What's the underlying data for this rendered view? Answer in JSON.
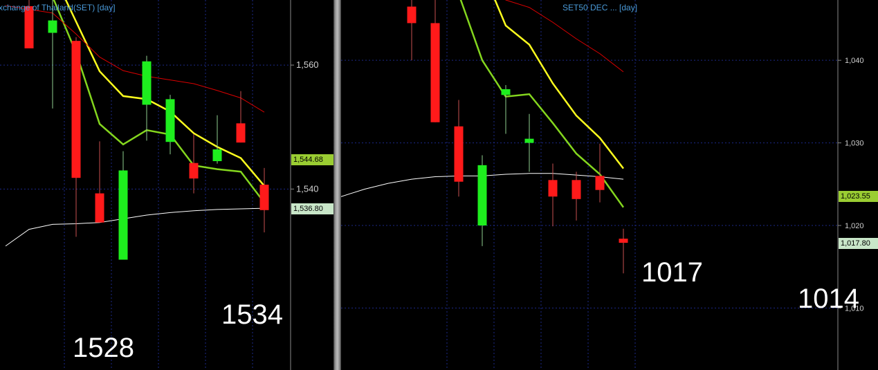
{
  "colors": {
    "background": "#000000",
    "grid": "#1c2a8a",
    "up_candle": "#1eee1e",
    "down_candle": "#ff1a1a",
    "wick": "#cfcfcf",
    "ma_fast": "#ffff1e",
    "ma_mid": "#84d61e",
    "ma_slow": "#dc0000",
    "ma_long": "#ffffff",
    "axis_text": "#d0d0d0",
    "title_text": "#4a9ad8",
    "tag_green": "#9acd32",
    "tag_light": "#c8e6c8"
  },
  "chart_data": [
    {
      "type": "candlestick",
      "title": "xchange of Thailand(SET) [day]",
      "ylim": [
        1510.8,
        1570.5
      ],
      "y_ticks": [
        1540,
        1560
      ],
      "y_tick_labels": [
        "1,540",
        "1,560"
      ],
      "gridlines": true,
      "last_price_tags": [
        {
          "label": "1,544.68",
          "value": 1544.68,
          "style": "green"
        },
        {
          "label": "1,536.80",
          "value": 1536.8,
          "style": "light"
        }
      ],
      "annotations": [
        {
          "text": "1528",
          "x": 5
        },
        {
          "text": "1534",
          "x": 11
        }
      ],
      "x": [
        1,
        2,
        3,
        4,
        5,
        6,
        7,
        8,
        9,
        10,
        11
      ],
      "candles": [
        {
          "open": 1569.5,
          "high": 1575,
          "low": 1565.8,
          "close": 1562.7
        },
        {
          "open": 1565.2,
          "high": 1573.2,
          "low": 1553.0,
          "close": 1567.2
        },
        {
          "open": 1563.9,
          "high": 1564.5,
          "low": 1532.3,
          "close": 1541.8
        },
        {
          "open": 1539.3,
          "high": 1547.7,
          "low": 1535.2,
          "close": 1534.6
        },
        {
          "open": 1528.6,
          "high": 1546.1,
          "low": 1529.1,
          "close": 1543.0
        },
        {
          "open": 1553.6,
          "high": 1561.5,
          "low": 1547.8,
          "close": 1560.6
        },
        {
          "open": 1547.6,
          "high": 1555.2,
          "low": 1545.6,
          "close": 1554.5
        },
        {
          "open": 1544.2,
          "high": 1548.9,
          "low": 1539.3,
          "close": 1541.7
        },
        {
          "open": 1544.5,
          "high": 1551.9,
          "low": 1544.1,
          "close": 1546.4
        },
        {
          "open": 1550.6,
          "high": 1555.8,
          "low": 1547.5,
          "close": 1547.5
        },
        {
          "open": 1540.7,
          "high": 1543.4,
          "low": 1533.0,
          "close": 1536.6
        }
      ],
      "series": [
        {
          "color": "#ffff1e",
          "x": [
            2,
            3,
            4,
            5,
            6,
            7,
            8,
            9,
            10,
            11
          ],
          "values": [
            1575,
            1567,
            1559,
            1555,
            1554.5,
            1552.5,
            1549,
            1546.8,
            1545,
            1540.5
          ]
        },
        {
          "color": "#84d61e",
          "x": [
            2,
            3,
            4,
            5,
            6,
            7,
            8,
            9,
            10,
            11
          ],
          "values": [
            1571,
            1562,
            1550.5,
            1547.2,
            1549.5,
            1548.8,
            1543.8,
            1543.2,
            1542.8,
            1537.8
          ]
        },
        {
          "color": "#dc0000",
          "x": [
            0,
            2,
            3,
            4,
            5,
            6,
            7,
            8,
            9,
            10,
            11
          ],
          "values": [
            1569.6,
            1568.4,
            1565.0,
            1561.3,
            1559.1,
            1558.2,
            1557.6,
            1557.0,
            1555.9,
            1554.7,
            1552.4
          ]
        },
        {
          "color": "#ffffff",
          "x": [
            0,
            1,
            2,
            3,
            4,
            5,
            6,
            7,
            8,
            9,
            10,
            11
          ],
          "values": [
            1530.8,
            1533.5,
            1534.3,
            1534.4,
            1534.6,
            1535.2,
            1535.8,
            1536.2,
            1536.5,
            1536.7,
            1536.8,
            1536.9
          ]
        }
      ]
    },
    {
      "type": "candlestick",
      "title": "SET50 DEC ...  [day]",
      "ylim": [
        1002.5,
        1047.3
      ],
      "y_ticks": [
        1010,
        1020,
        1030,
        1040
      ],
      "y_tick_labels": [
        "1,010",
        "1,020",
        "1,030",
        "1,040"
      ],
      "gridlines": true,
      "last_price_tags": [
        {
          "label": "1,023.55",
          "value": 1023.55,
          "style": "green"
        },
        {
          "label": "1,017.80",
          "value": 1017.8,
          "style": "light"
        }
      ],
      "annotations": [
        {
          "text": "1017",
          "x": 11
        },
        {
          "text": "1014",
          "x": 21
        }
      ],
      "x": [
        12,
        13,
        14,
        15,
        16,
        17,
        18,
        19,
        20,
        21
      ],
      "candles": [
        {
          "open": 1046.5,
          "high": 1048.0,
          "low": 1040.0,
          "close": 1044.5
        },
        {
          "open": 1044.5,
          "high": 1050.0,
          "low": 1032.5,
          "close": 1032.5
        },
        {
          "open": 1032.0,
          "high": 1035.2,
          "low": 1023.5,
          "close": 1025.3
        },
        {
          "open": 1020.0,
          "high": 1028.5,
          "low": 1017.5,
          "close": 1027.3
        },
        {
          "open": 1035.8,
          "high": 1037.0,
          "low": 1031.1,
          "close": 1036.5
        },
        {
          "open": 1030.0,
          "high": 1033.5,
          "low": 1026.5,
          "close": 1030.5
        },
        {
          "open": 1025.5,
          "high": 1027.5,
          "low": 1019.9,
          "close": 1023.5
        },
        {
          "open": 1025.5,
          "high": 1026.5,
          "low": 1020.6,
          "close": 1023.2
        },
        {
          "open": 1026.0,
          "high": 1029.9,
          "low": 1022.8,
          "close": 1024.3
        },
        {
          "open": 1018.4,
          "high": 1019.6,
          "low": 1014.2,
          "close": 1017.9
        }
      ],
      "series": [
        {
          "color": "#ffff1e",
          "x": [
            15,
            16,
            17,
            18,
            19,
            20,
            21
          ],
          "values": [
            1051,
            1044.2,
            1041.9,
            1037.2,
            1033.3,
            1030.6,
            1026.9
          ]
        },
        {
          "color": "#84d61e",
          "x": [
            14,
            15,
            16,
            17,
            18,
            19,
            20,
            21
          ],
          "values": [
            1048,
            1040.0,
            1035.6,
            1035.9,
            1032.4,
            1028.7,
            1026.2,
            1022.2
          ]
        },
        {
          "color": "#dc0000",
          "x": [
            15,
            16,
            17,
            18,
            19,
            20,
            21
          ],
          "values": [
            1049,
            1047.3,
            1046.4,
            1044.6,
            1042.6,
            1040.8,
            1038.6
          ]
        },
        {
          "color": "#ffffff",
          "x": [
            1,
            3,
            5,
            7,
            9,
            10,
            11,
            12,
            13,
            14,
            15,
            16,
            17,
            18,
            19,
            20,
            21
          ],
          "values": [
            1016.9,
            1018.8,
            1020.4,
            1022.3,
            1023.5,
            1024.4,
            1025.1,
            1025.6,
            1025.9,
            1026.0,
            1026.0,
            1026.2,
            1026.3,
            1026.3,
            1026.1,
            1025.9,
            1025.6
          ]
        }
      ]
    }
  ]
}
